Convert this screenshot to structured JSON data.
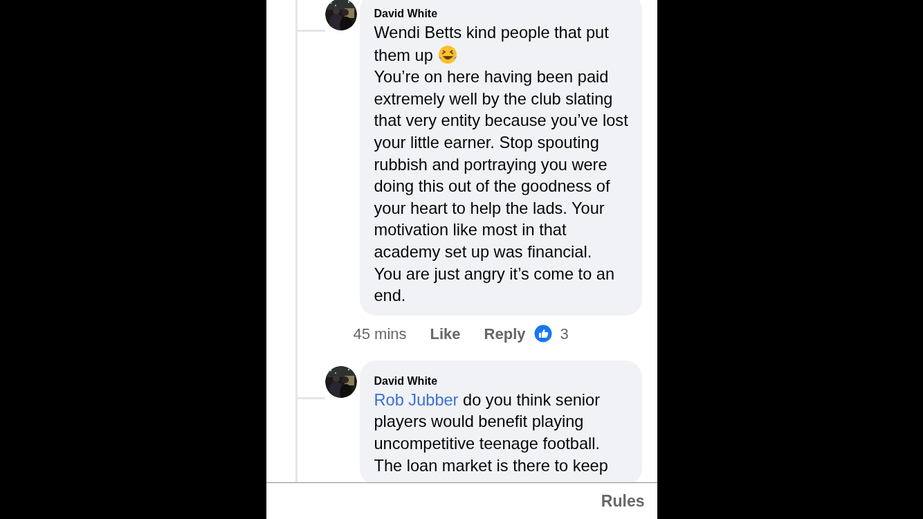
{
  "comments": [
    {
      "author": "David White",
      "paragraphs": [
        {
          "text": "Wendi Betts kind people that put them up",
          "trailing_emoji": true
        },
        {
          "text": "You’re on here having been paid extremely well by the club slating that very entity because you’ve lost your little earner. Stop spouting rubbish and portraying you were doing this out of the goodness of your heart to help the lads. Your motivation like most in that academy set up was financial.",
          "trailing_emoji": false
        },
        {
          "text": "You are just angry it’s come to an end.",
          "trailing_emoji": false
        }
      ],
      "meta": {
        "time": "45 mins",
        "like": "Like",
        "reply": "Reply",
        "reaction_count": "3"
      }
    },
    {
      "author": "David White",
      "paragraphs": [
        {
          "mention": "Rob Jubber",
          "text": "do you think senior players would benefit playing uncompetitive teenage football. The loan market is there to keep",
          "trailing_emoji": false
        }
      ]
    }
  ],
  "footer": {
    "rules": "Rules"
  }
}
